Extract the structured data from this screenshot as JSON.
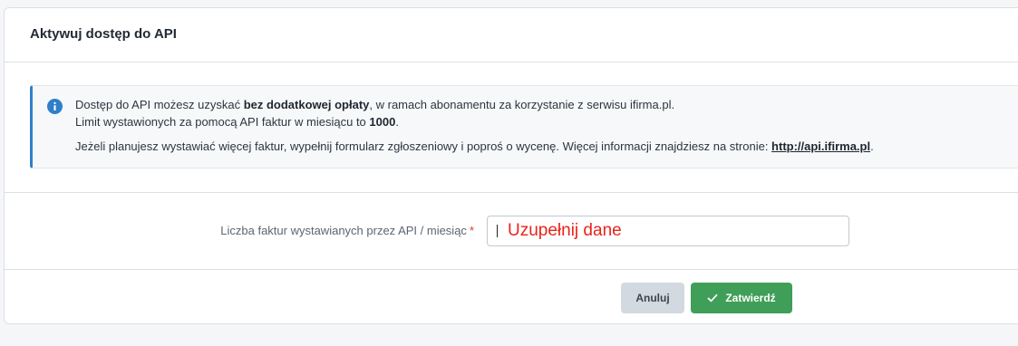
{
  "card": {
    "title": "Aktywuj dostęp do API"
  },
  "info": {
    "icon": "info-circle-icon",
    "line1_pre": "Dostęp do API możesz uzyskać ",
    "line1_bold": "bez dodatkowej opłaty",
    "line1_post": ", w ramach abonamentu za korzystanie z serwisu ifirma.pl.",
    "line2_pre": "Limit wystawionych za pomocą API faktur w miesiącu to ",
    "line2_bold": "1000",
    "line2_post": ".",
    "line3_pre": "Jeżeli planujesz wystawiać więcej faktur, wypełnij formularz zgłoszeniowy i poproś o wycenę. Więcej informacji znajdziesz na stronie: ",
    "line3_link": "http://api.ifirma.pl",
    "line3_post": "."
  },
  "form": {
    "label": "Liczba faktur wystawianych przez API / miesiąc",
    "required_mark": "*",
    "input_value": "",
    "input_hint": "Uzupełnij dane"
  },
  "actions": {
    "cancel_label": "Anuluj",
    "submit_label": "Zatwierdź",
    "submit_icon": "check-icon"
  },
  "colors": {
    "accent_blue": "#2f7fc9",
    "submit_green": "#3f9e57",
    "cancel_gray": "#d3d9e0",
    "required_red": "#d9363e",
    "hint_red": "#e8231b"
  }
}
